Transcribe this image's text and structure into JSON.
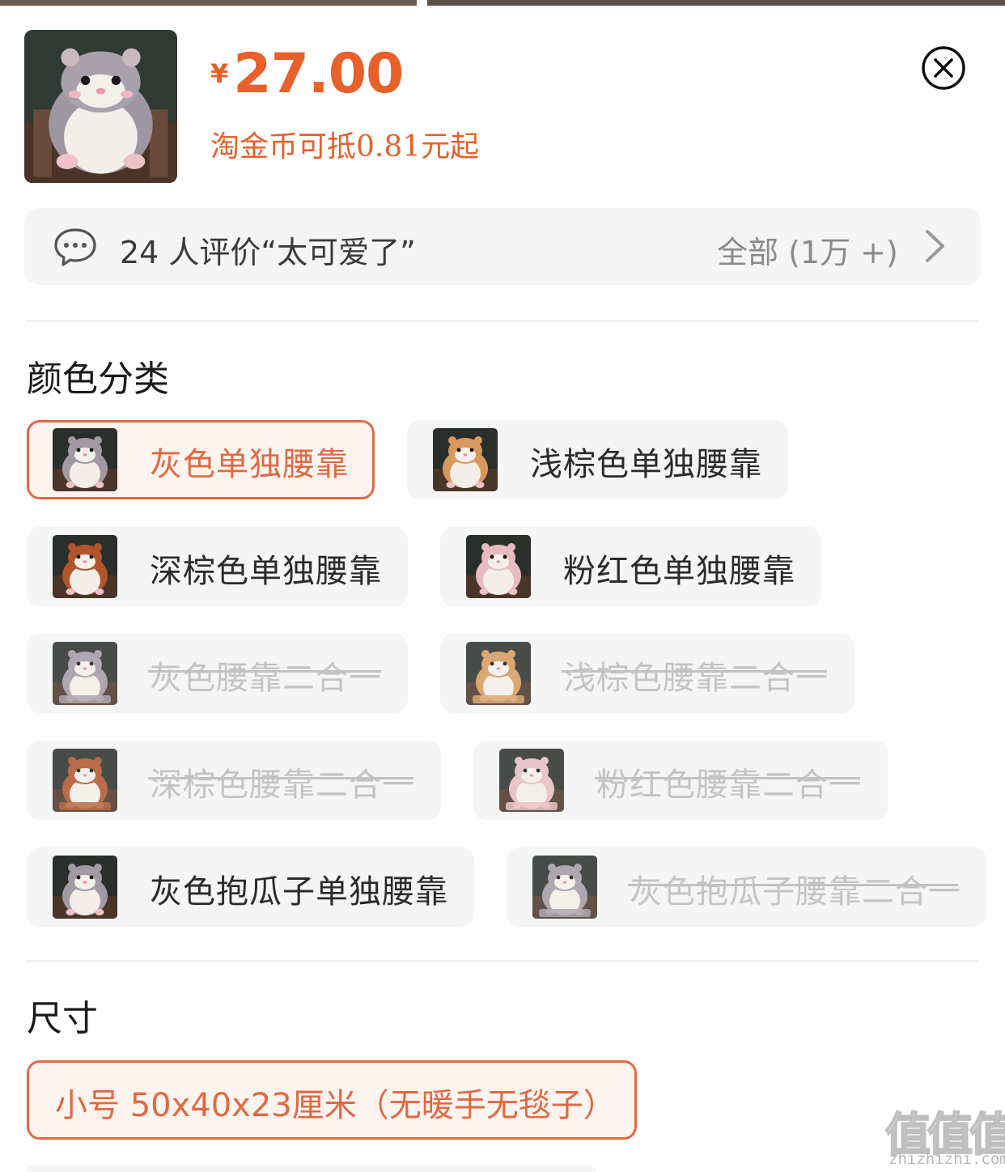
{
  "product": {
    "currency_symbol": "¥",
    "price": "27.00",
    "coin_text": "淘金币可抵0.81元起",
    "image_icon": "hamster-plush-icon"
  },
  "review": {
    "icon": "chat-bubble-icon",
    "text": "24 人评价“太可爱了”",
    "all_label": "全部 (1万 +)"
  },
  "color_section": {
    "title": "颜色分类",
    "options": [
      {
        "label": "灰色单独腰靠",
        "state": "selected",
        "color": "#a29aa3"
      },
      {
        "label": "浅棕色单独腰靠",
        "state": "available",
        "color": "#d79a5c"
      },
      {
        "label": "深棕色单独腰靠",
        "state": "available",
        "color": "#b2552a"
      },
      {
        "label": "粉红色单独腰靠",
        "state": "available",
        "color": "#e7bcc1"
      },
      {
        "label": "灰色腰靠二合一",
        "state": "disabled",
        "color": "#a29aa3"
      },
      {
        "label": "浅棕色腰靠二合一",
        "state": "disabled",
        "color": "#d79a5c"
      },
      {
        "label": "深棕色腰靠二合一",
        "state": "disabled",
        "color": "#b2552a"
      },
      {
        "label": "粉红色腰靠二合一",
        "state": "disabled",
        "color": "#e7bcc1"
      },
      {
        "label": "灰色抱瓜子单独腰靠",
        "state": "available",
        "color": "#a29aa3"
      },
      {
        "label": "灰色抱瓜子腰靠二合一",
        "state": "disabled",
        "color": "#a29aa3"
      }
    ]
  },
  "size_section": {
    "title": "尺寸",
    "options": [
      {
        "label": "小号 50x40x23厘米（无暖手无毯子）",
        "state": "selected"
      }
    ]
  },
  "watermark": {
    "glyphs": "值值值",
    "site": "zhizhizhi.com"
  },
  "colors": {
    "accent": "#e8602a",
    "chip_bg": "#f5f5f5",
    "disabled_text": "#c4c4c4"
  }
}
